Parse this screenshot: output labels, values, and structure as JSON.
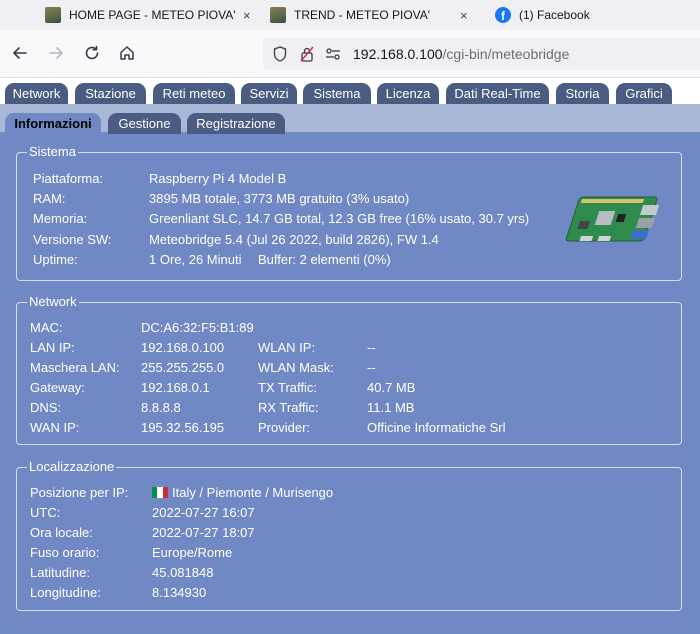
{
  "browser": {
    "tabs": [
      {
        "title": "HOME PAGE - METEO PIOVA'"
      },
      {
        "title": "TREND - METEO PIOVA'"
      },
      {
        "title": "(1) Facebook"
      }
    ],
    "close_glyph": "×",
    "url_host": "192.168.0.100",
    "url_path": "/cgi-bin/meteobridge"
  },
  "main_tabs": [
    "Network",
    "Stazione",
    "Reti meteo",
    "Servizi",
    "Sistema",
    "Licenza",
    "Dati Real-Time",
    "Storia",
    "Grafici"
  ],
  "sub_tabs": [
    "Informazioni",
    "Gestione",
    "Registrazione"
  ],
  "active_sub_tab": "Informazioni",
  "sistema": {
    "legend": "Sistema",
    "labels": [
      "Piattaforma:",
      "RAM:",
      "Memoria:",
      "Versione SW:",
      "Uptime:"
    ],
    "values": [
      "Raspberry Pi 4 Model B",
      "3895 MB totale, 3773 MB gratuito (3% usato)",
      "Greenliant SLC, 14.7 GB total, 12.3 GB free (16% usato, 30.7 yrs)",
      "Meteobridge 5.4 (Jul 26 2022, build 2826), FW 1.4",
      "1 Ore, 26 Minuti"
    ],
    "buffer": "Buffer: 2 elementi (0%)"
  },
  "network": {
    "legend": "Network",
    "left_labels": [
      "MAC:",
      "LAN IP:",
      "Maschera LAN:",
      "Gateway:",
      "DNS:",
      "WAN IP:"
    ],
    "left_values": [
      "DC:A6:32:F5:B1:89",
      "192.168.0.100",
      "255.255.255.0",
      "192.168.0.1",
      "8.8.8.8",
      "195.32.56.195"
    ],
    "right_labels": [
      "WLAN IP:",
      "WLAN Mask:",
      "TX Traffic:",
      "RX Traffic:",
      "Provider:"
    ],
    "right_values": [
      "--",
      "--",
      "40.7 MB",
      "11.1 MB",
      "Officine Informatiche Srl"
    ]
  },
  "localizzazione": {
    "legend": "Localizzazione",
    "labels": [
      "Posizione per IP:",
      "UTC:",
      "Ora locale:",
      "Fuso orario:",
      "Latitudine:",
      "Longitudine:"
    ],
    "values": [
      "Italy / Piemonte / Murisengo",
      "2022-07-27 16:07",
      "2022-07-27 18:07",
      "Europe/Rome",
      "45.081848",
      "8.134930"
    ],
    "flag_colors": [
      "#009246",
      "#ffffff",
      "#ce2b37"
    ]
  },
  "colors": {
    "page_bg": "#7089c4",
    "tab_bg": "#4b5c82",
    "subtab_strip": "#aab8d8"
  }
}
